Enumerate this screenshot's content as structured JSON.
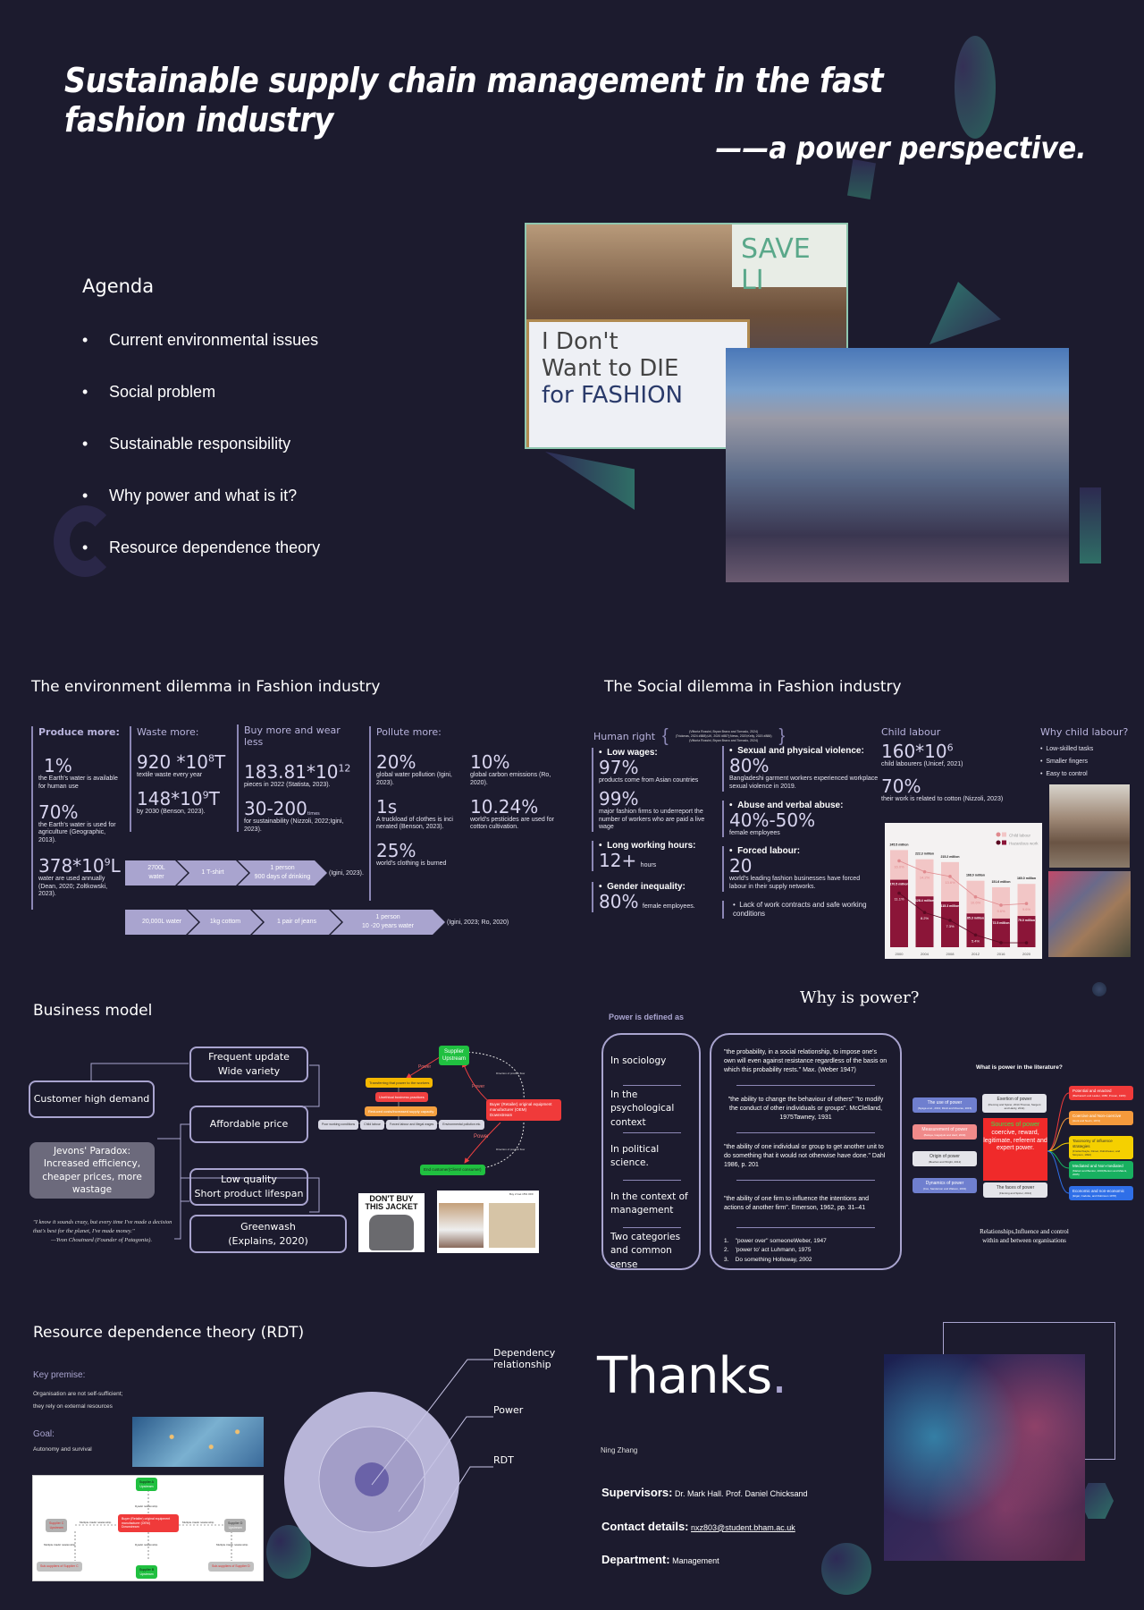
{
  "header": {
    "title": "Sustainable supply chain management in the fast fashion industry",
    "subtitle": "——a power perspective."
  },
  "agenda": {
    "heading": "Agenda",
    "items": [
      "Current environmental issues",
      "Social problem",
      "Sustainable responsibility",
      "Why power and what is it?",
      "Resource dependence theory"
    ]
  },
  "photos": {
    "protest_sign": [
      "I Don't",
      "Want to DIE",
      "for FASHION"
    ],
    "protest_background_sign": "SAVE LI"
  },
  "environment": {
    "heading": "The environment dilemma in Fashion industry",
    "produce": {
      "label": "Produce more:",
      "stats": [
        {
          "value": "1%",
          "desc": "the Earth's water is available for human use"
        },
        {
          "value": "70%",
          "desc": "the Earth's water is used for agriculture (Geographic, 2013)."
        },
        {
          "value": "378*10",
          "sup": "9",
          "unit": "L",
          "desc": "water are used annually (Dean, 2020; Zoltkowski, 2023)."
        }
      ]
    },
    "waste": {
      "label": "Waste more:",
      "stats": [
        {
          "value": "920 *10",
          "sup": "8",
          "unit": "T",
          "desc": "textile waste every year"
        },
        {
          "value": "148*10",
          "sup": "9",
          "unit": "T",
          "desc": "by 2030 (Benson, 2023)."
        }
      ]
    },
    "buy": {
      "label": "Buy more and wear less",
      "stats": [
        {
          "value": "183.81*10",
          "sup": "12",
          "unit": "",
          "desc": "pieces in 2022 (Statista, 2023)."
        },
        {
          "value": "30-200",
          "suffix": "times",
          "desc": "for sustainability (Nizzoli, 2022;Igini, 2023)."
        }
      ]
    },
    "pollute": {
      "label": "Pollute more:",
      "stats": [
        {
          "value": "20%",
          "desc": "global water pollution (Igini, 2023)."
        },
        {
          "value": "10%",
          "desc": "global carbon emissions (Ro, 2020)."
        },
        {
          "value": "1s",
          "desc": "A truckload of clothes is inci nerated (Benson, 2023)."
        },
        {
          "value": "10.24%",
          "desc": "world's pesticides are used for cotton cultivation."
        },
        {
          "value": "25%",
          "desc": "world's clothing is burned"
        }
      ]
    },
    "flow1": {
      "steps": [
        "2700L water",
        "1 T-shirt",
        "1 person\n900 days of drinking"
      ],
      "cite": "(Igini, 2023)."
    },
    "flow2": {
      "steps": [
        "20,000L water",
        "1kg cottom",
        "1 pair of jeans",
        "1 person\n10 -20 years water"
      ],
      "cite": "(Igini, 2023; Ro, 2020)"
    }
  },
  "social": {
    "heading": "The Social dilemma in Fashion industry",
    "human_right_label": "Human right",
    "human_right_refs": [
      "(Vittoria Rossini, Bryan Bravo and Tornado, 2024)",
      "(Trickmas, 2024 #888);UK, 2020 #887);News, 2020;Kelly, 2020 #888)",
      "(Vittoria Rossini, Bryan Bravo and Tornado, 2024)"
    ],
    "left_col": [
      {
        "heading": "Low wages:",
        "stats": [
          {
            "value": "97%",
            "desc": "products come from Asian countries"
          },
          {
            "value": "99%",
            "desc": "major fashion firms to underreport the number of workers who are paid a live wage"
          }
        ]
      },
      {
        "heading": "Long working hours:",
        "stats": [
          {
            "value": "12+",
            "inline": "hours"
          }
        ]
      },
      {
        "heading": "Gender inequality:",
        "stats": [
          {
            "value": "80%",
            "inline": "female employees."
          }
        ]
      }
    ],
    "mid_col": [
      {
        "heading": "Sexual and physical violence:",
        "value": "80%",
        "desc": "Bangladeshi garment workers experienced workplace sexual violence in 2019."
      },
      {
        "heading": "Abuse and verbal abuse:",
        "value": "40%-50%",
        "desc": "female employees"
      },
      {
        "heading": "Forced labour:",
        "value": "20",
        "desc": "world's leading fashion businesses have forced labour in their supply networks."
      },
      {
        "heading": "Lack of work contracts and safe working conditions",
        "value": "",
        "desc": ""
      }
    ],
    "child_labour": {
      "label": "Child labour",
      "stat1_value": "160*10",
      "stat1_sup": "6",
      "stat1_desc": "child labourers (Unicef, 2021)",
      "stat2_value": "70%",
      "stat2_desc": "their work is related to cotton (Nizzoli, 2023)"
    },
    "why_child": {
      "label": "Why child labour?",
      "items": [
        "Low-skilled tasks",
        "Smaller fingers",
        "Easy to control"
      ]
    }
  },
  "chart_data": {
    "type": "bar",
    "title": "",
    "categories": [
      "2000",
      "2004",
      "2008",
      "2012",
      "2016",
      "2020"
    ],
    "series": [
      {
        "name": "Child labour",
        "values": [
          245.5,
          222.3,
          215.2,
          168.0,
          151.6,
          160.0
        ],
        "percent": [
          16.0,
          14.2,
          13.6,
          10.6,
          9.6,
          9.6
        ],
        "color": "#f2c6c6",
        "line_color": "#e08a8e"
      },
      {
        "name": "Hazardous work",
        "values": [
          170.5,
          128.4,
          115.3,
          85.3,
          72.5,
          79.0
        ],
        "percent": [
          11.1,
          8.2,
          7.3,
          5.4,
          4.6,
          4.7
        ],
        "color": "#8b1538",
        "line_color": "#5a0a22"
      }
    ],
    "value_suffix": "million",
    "xlabel": "",
    "ylabel": "",
    "ylim": [
      0,
      260
    ],
    "legend": "top-right",
    "grid": false
  },
  "business": {
    "heading": "Business model",
    "boxes": {
      "demand": "Customer high demand",
      "frequent": "Frequent update\nWide variety",
      "price": "Affordable price",
      "quality": "Low quality\nShort product lifespan",
      "greenwash": "Greenwash\n(Explains, 2020)"
    },
    "jevons": "Jevons' Paradox:\nIncreased efficiency,\ncheaper prices, more\nwastage",
    "quote": "\"I know it sounds crazy, but every time I've made a decision that's best for the planet, I've made money.\"",
    "quote_author": "—Yvon Chouinard (Founder of Patagonia).",
    "flow": {
      "supplier": "Supplier",
      "supplier_sub": "Upstream",
      "buyer": "Buyer (Retailer) original equipment manufacturer (OEM)",
      "buyer_sub": "Downstream",
      "end": "End customer(Client/ consumer)",
      "power": "Power",
      "direction": "Direction of product flow",
      "transfer": "Transferring that power to the workers",
      "unethical": "Unethical business practices",
      "reduced": "Reduced costs/increased supply capacity",
      "effects": [
        "Poor working conditions",
        "Child labour",
        "Forced labour and illegal wages",
        "Environmental pollution etc."
      ]
    },
    "ad_jacket": "DON'T BUY\nTHIS JACKET",
    "ad_promo": "Buy 2 Get 15% OFF"
  },
  "power": {
    "heading": "Why is power?",
    "defined_as": "Power is defined as",
    "contexts": [
      "In sociology",
      "In the psychological context",
      "In political science.",
      "In the context of management",
      "Two categories and common sense"
    ],
    "quotes": [
      "\"the probability, in a social relationship, to impose one's own will even against resistance regardless of the basis on which this probability rests.\" Max. (Weber 1947)",
      "\"the ability to change the behaviour of others\" \"to modify the conduct of other individuals or groups\". McClelland, 1975Tawney, 1931",
      "\"the ability of one individual or group to get another unit to do something that it would not otherwise have done.\" Dahl 1986, p. 201",
      "\"the ability of one firm to influence the intentions and actions of another firm\". Emerson, 1962, pp. 31–41"
    ],
    "categories": [
      "\"power over\" someoneWeber, 1947",
      "'power to' act Luhmann, 1975",
      "Do something Holloway, 2002"
    ],
    "mindmap": {
      "title": "What is power in the literature?",
      "left": [
        {
          "label": "The use of power",
          "ref": "(Nyaga et al., 2013; Rindt and Mouzas, 2015)",
          "color": "#6f7fcf"
        },
        {
          "label": "Measurement of power",
          "ref": "(Belaya, Gagalyuk and Hanf, 2009)",
          "color": "#f08a8a"
        },
        {
          "label": "Origin of power",
          "ref": "(Meehan and Wright, 2012)",
          "color": "#e4e4ea"
        },
        {
          "label": "Dynamics of power",
          "ref": "(Cox, Sanderson and Watson, 2001)",
          "color": "#6f7fcf"
        }
      ],
      "center_top": {
        "label": "Exertion of power",
        "ref": "(Fleming and Spicer, 2014;Thomas, Sargent and Hardy, 2011)"
      },
      "center_title": "Sources of power",
      "center_body": "coercive, reward, legitimate, referent and expert power.",
      "center_bottom": {
        "label": "The faces of power",
        "ref": "(Fleming and Spicer, 2014)"
      },
      "right": [
        {
          "label": "Potential and enacted",
          "ref": "(Bacharach and Lawler, 1980; Provan, 1980)",
          "color": "#f03a3a"
        },
        {
          "label": "Coercive and Non-coercive",
          "ref": "(Hunt and Nevin, 1974)",
          "color": "#f59a3c"
        },
        {
          "label": "Taxonomy of influence strategies",
          "ref": "(Frazier/Gayle, Dinsel, Robicheaux, and Simpson, 1992)",
          "color": "#f5d000"
        },
        {
          "label": "Mediated and Non-mediated",
          "ref": "(Maloni and Benton, 2000;Benton and Maloni, 2005)",
          "color": "#18b060"
        },
        {
          "label": "Economic and non-economic",
          "ref": "(Etgar, Cadotte, and Robinson 1978)",
          "color": "#2f6fe8"
        }
      ],
      "caption": "Relationships,Influence and control\nwithin and between organisations"
    }
  },
  "rdt": {
    "heading": "Resource dependence theory (RDT)",
    "premise_label": "Key premise:",
    "premise_lines": [
      "Organisation are not self-sufficient;",
      "they rely on external resources"
    ],
    "goal_label": "Goal:",
    "goal_text": "Autonomy and survival",
    "rings": [
      "Dependency relationship",
      "Power",
      "RDT"
    ],
    "diagram": {
      "supplier_a": "Supplier A",
      "supplier_b": "Supplier B",
      "supplier_c": "Supplier C",
      "supplier_d": "Supplier D",
      "upstream": "Upstream",
      "buyer": "Buyer (Retailer) original equipment manufacturer (OEM)",
      "downstream": "Downstream",
      "dyadic": "Dyadic relationship",
      "triadic": "Multiple triadic relationship",
      "sub_c": "Sub-suppliers of Supplier C",
      "sub_d": "Sub-suppliers of Supplier D"
    }
  },
  "thanks": {
    "heading": "Thanks",
    "author": "Ning Zhang",
    "supervisors_label": "Supervisors:",
    "supervisors": "Dr. Mark Hall. Prof. Daniel Chicksand",
    "contact_label": "Contact details:",
    "contact": "nxz803@student.bham.ac.uk",
    "department_label": "Department:",
    "department": "Management"
  }
}
